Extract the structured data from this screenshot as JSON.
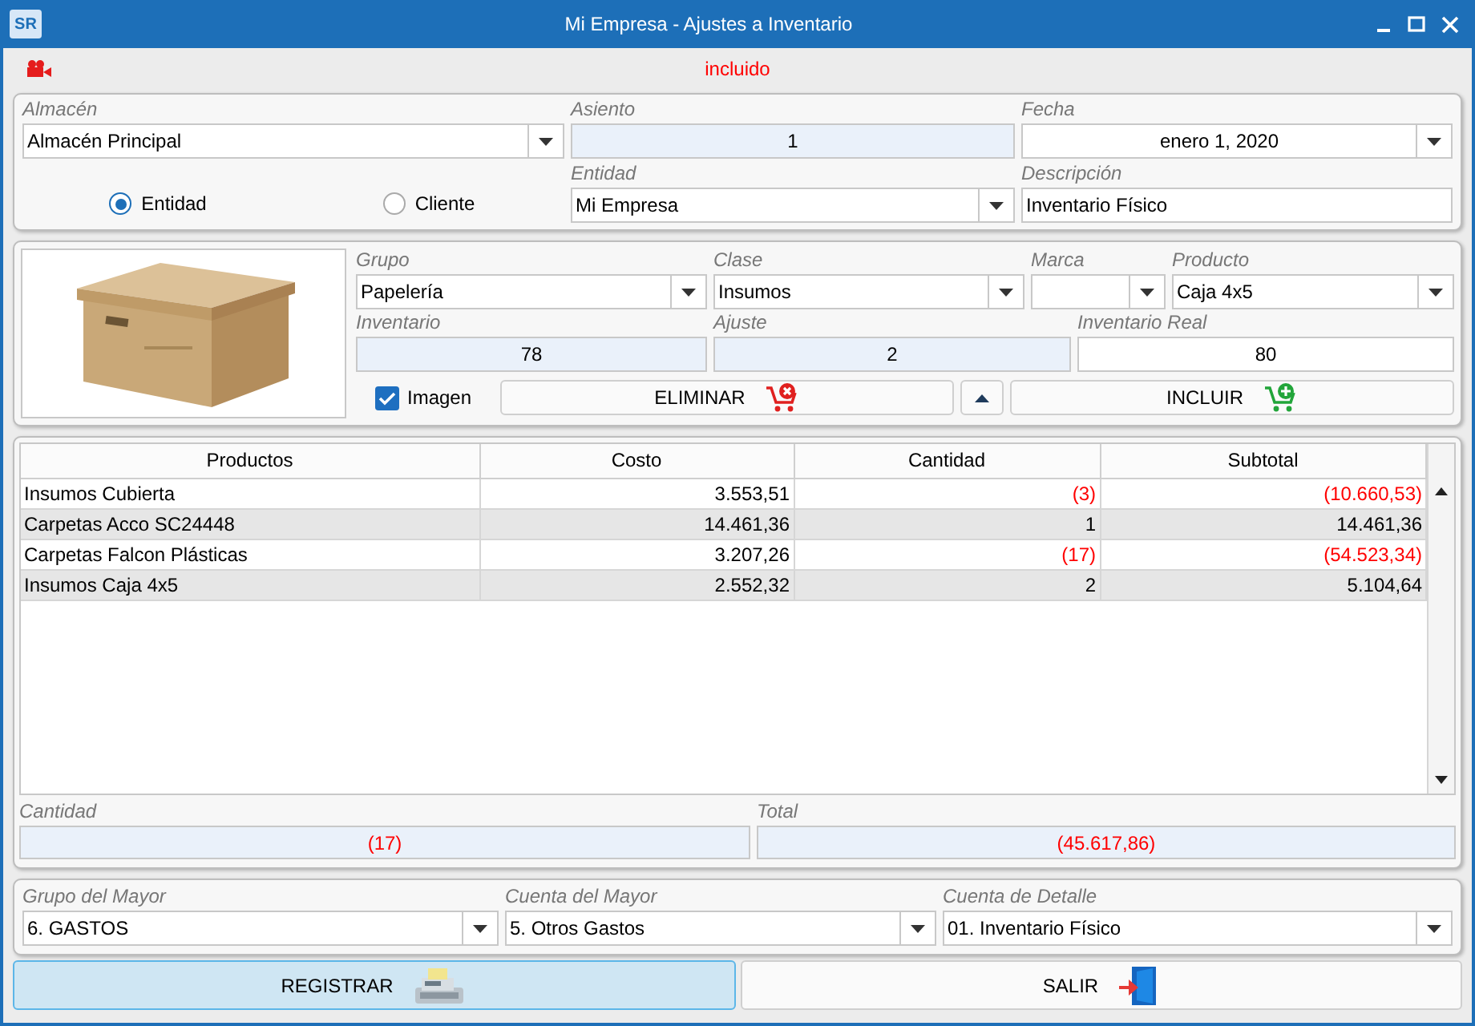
{
  "window": {
    "logo": "SR",
    "title": "Mi Empresa - Ajustes a Inventario"
  },
  "status": {
    "text": "incluido"
  },
  "header": {
    "almacen": {
      "label": "Almacén",
      "value": "Almacén Principal",
      "kind": "select"
    },
    "asiento": {
      "label": "Asiento",
      "value": "1",
      "kind": "readonly"
    },
    "fecha": {
      "label": "Fecha",
      "value": "enero 1, 2020",
      "kind": "select_center"
    },
    "radios": [
      {
        "label": "Entidad",
        "selected": true
      },
      {
        "label": "Cliente",
        "selected": false
      }
    ],
    "entidad": {
      "label": "Entidad",
      "value": "Mi Empresa",
      "kind": "select"
    },
    "descripcion": {
      "label": "Descripción",
      "value": "Inventario Físico",
      "kind": "input"
    }
  },
  "product": {
    "grupo": {
      "label": "Grupo",
      "value": "Papelería",
      "kind": "select"
    },
    "clase": {
      "label": "Clase",
      "value": "Insumos",
      "kind": "select"
    },
    "marca": {
      "label": "Marca",
      "kind": "select"
    },
    "producto": {
      "label": "Producto",
      "value": "Caja 4x5",
      "kind": "select"
    },
    "inventario": {
      "label": "Inventario",
      "value": "78",
      "kind": "readonly"
    },
    "ajuste": {
      "label": "Ajuste",
      "value": "2",
      "kind": "readonly"
    },
    "inventario_real": {
      "label": "Inventario Real",
      "value": "80",
      "kind": "input_center"
    },
    "imagen": {
      "label": "Imagen",
      "checked": true
    },
    "buttons": [
      {
        "kind": "remove",
        "label": "ELIMINAR"
      },
      {
        "kind": "up"
      },
      {
        "kind": "add",
        "label": "INCLUIR"
      }
    ]
  },
  "table": {
    "columns": [
      "Productos",
      "Costo",
      "Cantidad",
      "Subtotal"
    ],
    "rows": [
      {
        "producto": "Insumos Cubierta",
        "costo": "3.553,51",
        "cantidad": "(3)",
        "subtotal": "(10.660,53)",
        "negative": true
      },
      {
        "producto": "Carpetas Acco SC24448",
        "costo": "14.461,36",
        "cantidad": "1",
        "subtotal": "14.461,36",
        "negative": false
      },
      {
        "producto": "Carpetas Falcon Plásticas",
        "costo": "3.207,26",
        "cantidad": "(17)",
        "subtotal": "(54.523,34)",
        "negative": true
      },
      {
        "producto": "Insumos Caja 4x5",
        "costo": "2.552,32",
        "cantidad": "2",
        "subtotal": "5.104,64",
        "negative": false
      }
    ]
  },
  "totals": [
    {
      "label": "Cantidad",
      "value": "(17)",
      "negative": true
    },
    {
      "label": "Total",
      "value": "(45.617,86)",
      "negative": true
    }
  ],
  "accounts": [
    {
      "label": "Grupo del Mayor",
      "value": "6. GASTOS",
      "kind": "select"
    },
    {
      "label": "Cuenta del Mayor",
      "value": "5. Otros Gastos",
      "kind": "select"
    },
    {
      "label": "Cuenta de Detalle",
      "value": "01. Inventario Físico",
      "kind": "select"
    }
  ],
  "actions": [
    {
      "kind": "register",
      "label": "REGISTRAR",
      "focused": true
    },
    {
      "kind": "exit",
      "label": "SALIR",
      "focused": false
    }
  ]
}
